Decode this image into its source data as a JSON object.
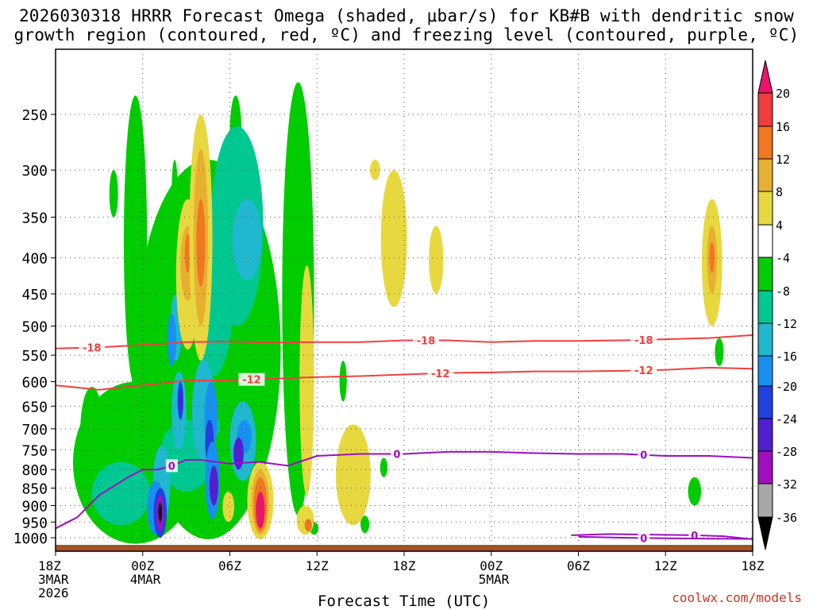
{
  "title": "2026030318 HRRR Forecast Omega (shaded, μbar/s) for KB#B with dendritic snow\ngrowth region (contoured, red, ºC) and freezing level (contoured, purple, ºC)",
  "credit": "coolwx.com/models",
  "chart_data": {
    "type": "time-height section",
    "title": "2026030318 HRRR Forecast Omega (shaded, μbar/s) for KB#B with dendritic snow growth region (contoured, red, ºC) and freezing level (contoured, purple, ºC)",
    "xlabel": "Forecast Time (UTC)",
    "ylabel": "",
    "x_ticks": [
      {
        "lines": [
          "18Z",
          "3MAR",
          "2026"
        ],
        "hour": 0
      },
      {
        "lines": [
          "00Z",
          "4MAR"
        ],
        "hour": 6
      },
      {
        "lines": [
          "06Z"
        ],
        "hour": 12
      },
      {
        "lines": [
          "12Z"
        ],
        "hour": 18
      },
      {
        "lines": [
          "18Z"
        ],
        "hour": 24
      },
      {
        "lines": [
          "00Z",
          "5MAR"
        ],
        "hour": 30
      },
      {
        "lines": [
          "06Z"
        ],
        "hour": 36
      },
      {
        "lines": [
          "12Z"
        ],
        "hour": 42
      },
      {
        "lines": [
          "18Z"
        ],
        "hour": 48
      }
    ],
    "xlim_hours": [
      0,
      48
    ],
    "y_ticks": [
      250,
      300,
      350,
      400,
      450,
      500,
      550,
      600,
      650,
      700,
      750,
      800,
      850,
      900,
      950,
      1000
    ],
    "ylim_hPa": [
      1030,
      200
    ],
    "y_scale": "log pressure",
    "grid": true,
    "colorbar": {
      "labels": [
        "20",
        "16",
        "12",
        "8",
        "4",
        "-4",
        "-8",
        "-12",
        "-16",
        "-20",
        "-24",
        "-28",
        "-32",
        "-36"
      ],
      "colors": [
        "#e8156b",
        "#f03c3c",
        "#f07820",
        "#e8b030",
        "#e8d840",
        "#ffffff",
        "#00cc00",
        "#00c890",
        "#20b8d0",
        "#1890f0",
        "#2040e0",
        "#5020d0",
        "#a010c0",
        "#a8a8a8",
        "#000000"
      ]
    },
    "contours": [
      {
        "name": "dendritic -18",
        "label": "-18",
        "color": "#f04040",
        "points": [
          [
            0,
            538
          ],
          [
            3,
            536
          ],
          [
            6,
            532
          ],
          [
            9,
            527
          ],
          [
            12,
            526
          ],
          [
            15,
            528
          ],
          [
            18,
            527
          ],
          [
            21,
            527
          ],
          [
            24,
            524
          ],
          [
            27,
            524
          ],
          [
            30,
            527
          ],
          [
            33,
            525
          ],
          [
            36,
            525
          ],
          [
            39,
            524
          ],
          [
            42,
            522
          ],
          [
            45,
            520
          ],
          [
            48,
            515
          ]
        ],
        "labels_at": [
          2.5,
          25.5,
          40.5
        ]
      },
      {
        "name": "dendritic -12",
        "label": "-12",
        "color": "#f04040",
        "points": [
          [
            0,
            607
          ],
          [
            3,
            616
          ],
          [
            6,
            607
          ],
          [
            9,
            598
          ],
          [
            12,
            597
          ],
          [
            15,
            594
          ],
          [
            18,
            591
          ],
          [
            21,
            589
          ],
          [
            24,
            586
          ],
          [
            27,
            583
          ],
          [
            30,
            582
          ],
          [
            33,
            580
          ],
          [
            36,
            580
          ],
          [
            39,
            579
          ],
          [
            42,
            577
          ],
          [
            45,
            573
          ],
          [
            48,
            575
          ]
        ],
        "labels_at": [
          13.5,
          26.5,
          40.5
        ]
      },
      {
        "name": "freezing level 0",
        "label": "0",
        "color": "#9a10c0",
        "points": [
          [
            0,
            970
          ],
          [
            1.5,
            935
          ],
          [
            3,
            870
          ],
          [
            5,
            820
          ],
          [
            6,
            800
          ],
          [
            7,
            800
          ],
          [
            8,
            790
          ],
          [
            9,
            775
          ],
          [
            10,
            775
          ],
          [
            12,
            785
          ],
          [
            14,
            780
          ],
          [
            16,
            790
          ],
          [
            18,
            765
          ],
          [
            21,
            760
          ],
          [
            24,
            760
          ],
          [
            27,
            755
          ],
          [
            30,
            755
          ],
          [
            33,
            758
          ],
          [
            36,
            760
          ],
          [
            39,
            760
          ],
          [
            42,
            765
          ],
          [
            45,
            765
          ],
          [
            48,
            770
          ]
        ],
        "labels_at": [
          8,
          23.5,
          40.5
        ]
      },
      {
        "name": "freezing level 0 (lower)",
        "label": "0",
        "color": "#9a10c0",
        "points": [
          [
            35.5,
            992
          ],
          [
            38,
            988
          ],
          [
            41,
            990
          ],
          [
            44,
            992
          ],
          [
            46,
            995
          ],
          [
            48,
            1005
          ]
        ],
        "labels_at": [
          44
        ]
      },
      {
        "name": "freezing level 0 (lowest)",
        "label": "0",
        "color": "#9a10c0",
        "points": [
          [
            36,
            997
          ],
          [
            39,
            1000
          ],
          [
            42,
            1002
          ],
          [
            45,
            1003
          ],
          [
            48,
            1004
          ]
        ],
        "labels_at": [
          40.5
        ]
      }
    ],
    "omega_note": "shaded omega field drawn approximately as blobs; values in μbar/s by colorbar bands",
    "omega_blobs": [
      {
        "hour": 10.5,
        "p_top": 290,
        "p_bot": 1005,
        "half_width_h": 5.0,
        "level": -8
      },
      {
        "hour": 16.7,
        "p_top": 225,
        "p_bot": 930,
        "half_width_h": 1.1,
        "level": -8
      },
      {
        "hour": 5.5,
        "p_top": 600,
        "p_bot": 1020,
        "half_width_h": 4.3,
        "level": -8
      },
      {
        "hour": 5.5,
        "p_top": 235,
        "p_bot": 610,
        "half_width_h": 0.8,
        "level": -8
      },
      {
        "hour": 4.0,
        "p_top": 300,
        "p_bot": 350,
        "half_width_h": 0.3,
        "level": -8
      },
      {
        "hour": 2.5,
        "p_top": 610,
        "p_bot": 820,
        "half_width_h": 0.8,
        "level": -8
      },
      {
        "hour": 12.4,
        "p_top": 235,
        "p_bot": 300,
        "half_width_h": 0.4,
        "level": -8
      },
      {
        "hour": 19.8,
        "p_top": 560,
        "p_bot": 640,
        "half_width_h": 0.25,
        "level": -8
      },
      {
        "hour": 22.6,
        "p_top": 770,
        "p_bot": 820,
        "half_width_h": 0.25,
        "level": -8
      },
      {
        "hour": 45.7,
        "p_top": 520,
        "p_bot": 570,
        "half_width_h": 0.3,
        "level": -8
      },
      {
        "hour": 44.0,
        "p_top": 820,
        "p_bot": 900,
        "half_width_h": 0.45,
        "level": -8
      },
      {
        "hour": 17.8,
        "p_top": 950,
        "p_bot": 990,
        "half_width_h": 0.3,
        "level": -8
      },
      {
        "hour": 21.3,
        "p_top": 930,
        "p_bot": 985,
        "half_width_h": 0.3,
        "level": -8
      },
      {
        "hour": 11.9,
        "p_top": 860,
        "p_bot": 950,
        "half_width_h": 0.4,
        "level": 4
      },
      {
        "hour": 17.3,
        "p_top": 410,
        "p_bot": 870,
        "half_width_h": 0.5,
        "level": 4
      },
      {
        "hour": 20.5,
        "p_top": 690,
        "p_bot": 960,
        "half_width_h": 1.2,
        "level": 4
      },
      {
        "hour": 23.3,
        "p_top": 300,
        "p_bot": 470,
        "half_width_h": 0.9,
        "level": 4
      },
      {
        "hour": 26.2,
        "p_top": 360,
        "p_bot": 450,
        "half_width_h": 0.5,
        "level": 4
      },
      {
        "hour": 22.0,
        "p_top": 290,
        "p_bot": 310,
        "half_width_h": 0.35,
        "level": 4
      },
      {
        "hour": 10.5,
        "p_top": 660,
        "p_bot": 730,
        "half_width_h": 0.8,
        "level": -12
      },
      {
        "hour": 10.8,
        "p_top": 330,
        "p_bot": 590,
        "half_width_h": 1.5,
        "level": -12
      },
      {
        "hour": 12.5,
        "p_top": 260,
        "p_bot": 500,
        "half_width_h": 1.8,
        "level": -12
      },
      {
        "hour": 9.0,
        "p_top": 680,
        "p_bot": 860,
        "half_width_h": 1.8,
        "level": -12
      },
      {
        "hour": 4.5,
        "p_top": 780,
        "p_bot": 960,
        "half_width_h": 2.0,
        "level": -12
      },
      {
        "hour": 13.2,
        "p_top": 330,
        "p_bot": 430,
        "half_width_h": 1.0,
        "level": -16
      },
      {
        "hour": 10.2,
        "p_top": 560,
        "p_bot": 780,
        "half_width_h": 0.8,
        "level": -16
      },
      {
        "hour": 12.9,
        "p_top": 640,
        "p_bot": 830,
        "half_width_h": 0.9,
        "level": -16
      },
      {
        "hour": 8.5,
        "p_top": 580,
        "p_bot": 750,
        "half_width_h": 0.5,
        "level": -16
      },
      {
        "hour": 7.3,
        "p_top": 740,
        "p_bot": 950,
        "half_width_h": 0.6,
        "level": -16
      },
      {
        "hour": 10.7,
        "p_top": 600,
        "p_bot": 760,
        "half_width_h": 0.45,
        "level": -20
      },
      {
        "hour": 13.0,
        "p_top": 680,
        "p_bot": 760,
        "half_width_h": 0.5,
        "level": -20
      },
      {
        "hour": 7.3,
        "p_top": 850,
        "p_bot": 960,
        "half_width_h": 0.35,
        "level": -20
      },
      {
        "hour": 10.6,
        "p_top": 680,
        "p_bot": 790,
        "half_width_h": 0.3,
        "level": -24
      },
      {
        "hour": 12.6,
        "p_top": 720,
        "p_bot": 800,
        "half_width_h": 0.35,
        "level": -28
      },
      {
        "hour": 8.6,
        "p_top": 600,
        "p_bot": 680,
        "half_width_h": 0.2,
        "level": -24
      },
      {
        "hour": 8.6,
        "p_top": 620,
        "p_bot": 660,
        "half_width_h": 0.1,
        "level": -28
      },
      {
        "hour": 8.3,
        "p_top": 450,
        "p_bot": 560,
        "half_width_h": 0.4,
        "level": -16
      },
      {
        "hour": 8.0,
        "p_top": 480,
        "p_bot": 570,
        "half_width_h": 0.3,
        "level": -20
      },
      {
        "hour": 6.9,
        "p_top": 830,
        "p_bot": 990,
        "half_width_h": 0.6,
        "level": -20
      },
      {
        "hour": 7.2,
        "p_top": 850,
        "p_bot": 1000,
        "half_width_h": 0.45,
        "level": -24
      },
      {
        "hour": 7.2,
        "p_top": 870,
        "p_bot": 980,
        "half_width_h": 0.25,
        "level": -32
      },
      {
        "hour": 7.2,
        "p_top": 890,
        "p_bot": 950,
        "half_width_h": 0.12,
        "level": -36
      },
      {
        "hour": 10.8,
        "p_top": 730,
        "p_bot": 940,
        "half_width_h": 0.5,
        "level": -20
      },
      {
        "hour": 10.9,
        "p_top": 790,
        "p_bot": 900,
        "half_width_h": 0.3,
        "level": -28
      },
      {
        "hour": 8.2,
        "p_top": 290,
        "p_bot": 350,
        "half_width_h": 0.2,
        "level": -8
      },
      {
        "hour": 9.1,
        "p_top": 330,
        "p_bot": 540,
        "half_width_h": 0.8,
        "level": 4
      },
      {
        "hour": 9.1,
        "p_top": 360,
        "p_bot": 460,
        "half_width_h": 0.5,
        "level": 8
      },
      {
        "hour": 9.1,
        "p_top": 370,
        "p_bot": 420,
        "half_width_h": 0.2,
        "level": 12
      },
      {
        "hour": 10.0,
        "p_top": 250,
        "p_bot": 560,
        "half_width_h": 0.8,
        "level": 4
      },
      {
        "hour": 10.0,
        "p_top": 280,
        "p_bot": 500,
        "half_width_h": 0.5,
        "level": 8
      },
      {
        "hour": 10.0,
        "p_top": 330,
        "p_bot": 440,
        "half_width_h": 0.3,
        "level": 12
      },
      {
        "hour": 14.1,
        "p_top": 780,
        "p_bot": 1005,
        "half_width_h": 0.9,
        "level": 4
      },
      {
        "hour": 14.1,
        "p_top": 800,
        "p_bot": 990,
        "half_width_h": 0.6,
        "level": 8
      },
      {
        "hour": 14.1,
        "p_top": 820,
        "p_bot": 980,
        "half_width_h": 0.45,
        "level": 12
      },
      {
        "hour": 14.1,
        "p_top": 860,
        "p_bot": 970,
        "half_width_h": 0.3,
        "level": 20
      },
      {
        "hour": 17.2,
        "p_top": 900,
        "p_bot": 990,
        "half_width_h": 0.6,
        "level": 4
      },
      {
        "hour": 17.4,
        "p_top": 940,
        "p_bot": 980,
        "half_width_h": 0.25,
        "level": 12
      },
      {
        "hour": 45.2,
        "p_top": 330,
        "p_bot": 500,
        "half_width_h": 0.7,
        "level": 4
      },
      {
        "hour": 45.2,
        "p_top": 360,
        "p_bot": 450,
        "half_width_h": 0.35,
        "level": 8
      },
      {
        "hour": 45.2,
        "p_top": 380,
        "p_bot": 420,
        "half_width_h": 0.18,
        "level": 12
      }
    ]
  }
}
